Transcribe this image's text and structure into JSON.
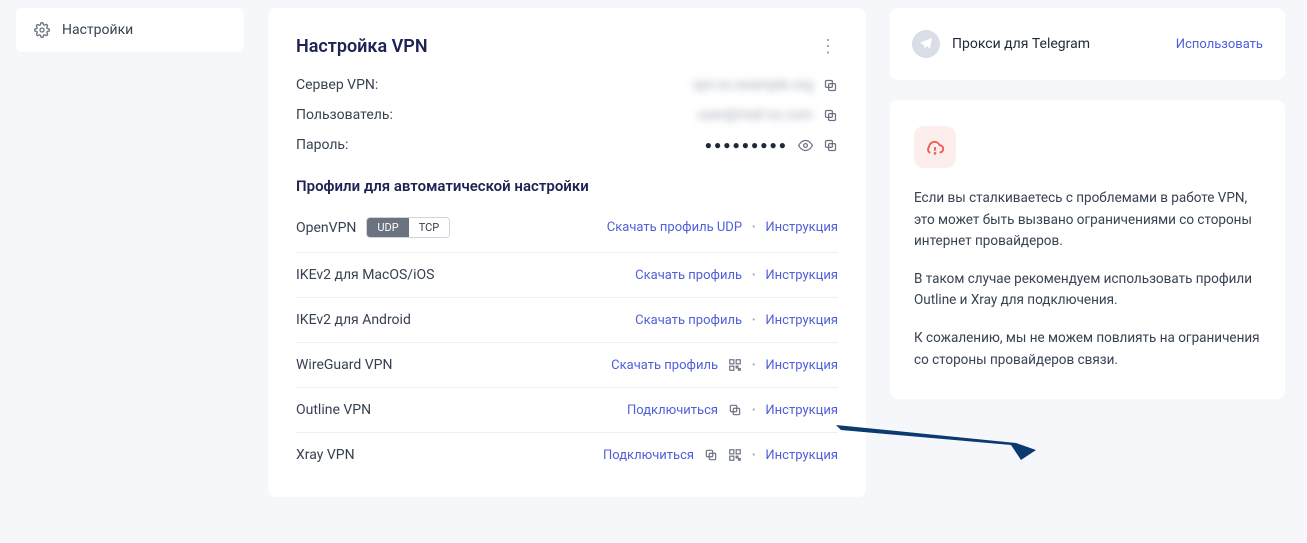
{
  "sidebar": {
    "settings_label": "Настройки"
  },
  "vpn": {
    "title": "Настройка VPN",
    "server_label": "Сервер VPN:",
    "server_value": "vpn-xx.example.org",
    "user_label": "Пользователь:",
    "user_value": "user@mail-xx.com",
    "password_label": "Пароль:",
    "password_mask": "●●●●●●●●●",
    "profiles_title": "Профили для автоматической настройки",
    "profiles": [
      {
        "name": "OpenVPN",
        "toggle": [
          "UDP",
          "TCP"
        ],
        "primary": "Скачать профиль UDP",
        "extra": ""
      },
      {
        "name": "IKEv2 для MacOS/iOS",
        "primary": "Скачать профиль",
        "extra": ""
      },
      {
        "name": "IKEv2 для Android",
        "primary": "Скачать профиль",
        "extra": ""
      },
      {
        "name": "WireGuard VPN",
        "primary": "Скачать профиль",
        "extra": "qr"
      },
      {
        "name": "Outline VPN",
        "primary": "Подключиться",
        "extra": "copy"
      },
      {
        "name": "Xray VPN",
        "primary": "Подключиться",
        "extra": "copy_qr"
      }
    ],
    "instruction_label": "Инструкция"
  },
  "telegram": {
    "title": "Прокси для Telegram",
    "action": "Использовать"
  },
  "notice": {
    "p1": "Если вы сталкиваетесь с проблемами в работе VPN, это может быть вызвано ограничениями со стороны интернет провайдеров.",
    "p2": "В таком случае рекомендуем использовать профили Outline и Xray для подключения.",
    "p3": "К сожалению, мы не можем повлиять на ограничения со стороны провайдеров связи."
  }
}
